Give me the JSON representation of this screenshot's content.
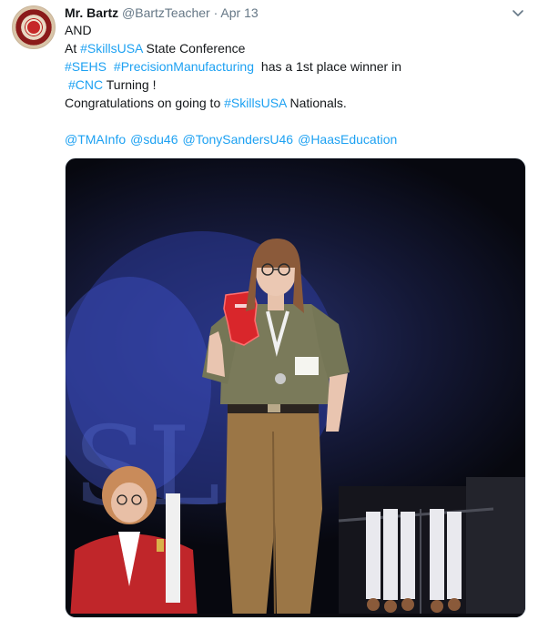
{
  "tweet": {
    "author_name": "Mr. Bartz",
    "author_handle": "@BartzTeacher",
    "separator": "·",
    "timestamp": "Apr 13",
    "avatar_icon": "school-seal-avatar-icon",
    "menu_icon": "chevron-down-icon",
    "accent_color": "#1da1f2",
    "lines": {
      "l1": "AND",
      "l2_a": "At ",
      "l2_tag": "#SkillsUSA",
      "l2_b": " State Conference",
      "l3_tag1": "#SEHS",
      "l3_tag2": "#PrecisionManufacturing",
      "l3_b": " has a 1st place winner in",
      "l4_tag": "#CNC",
      "l4_b": " Turning !",
      "l5_a": "Congratulations on going to ",
      "l5_tag": "#SkillsUSA",
      "l5_b": " Nationals.",
      "mentions": [
        "@TMAInfo",
        "@sdu46",
        "@TonySandersU46",
        "@HaasEducation"
      ]
    },
    "photo_description_icon": "award-photo"
  }
}
